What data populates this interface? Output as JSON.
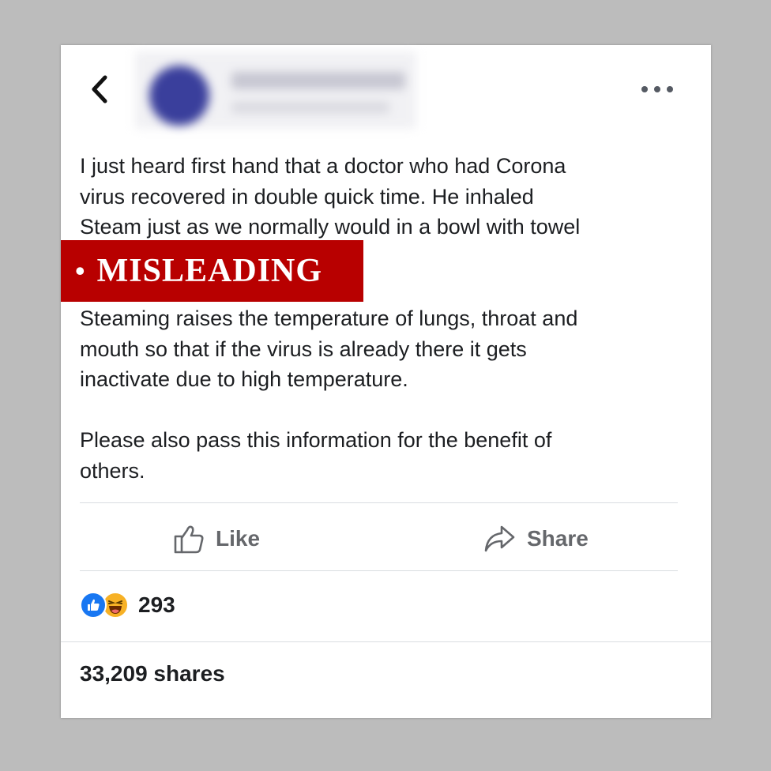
{
  "post": {
    "text_before": "I just heard first hand that a doctor who had Corona\nvirus recovered in double quick time. He inhaled\nSteam just as we normally would in a bowl with towel",
    "text_after": "Steaming raises the temperature of lungs, throat and\nmouth so that if the virus is already there it gets\ninactivate due to high temperature.\n\nPlease also pass this information for the benefit of\nothers."
  },
  "label": {
    "bullet": "•",
    "text": "MISLEADING",
    "color": "#b80000"
  },
  "actions": {
    "like_label": "Like",
    "share_label": "Share"
  },
  "reactions": {
    "count": "293",
    "icons": [
      "like-icon",
      "haha-icon"
    ]
  },
  "shares": {
    "text": "33,209 shares"
  },
  "colors": {
    "background": "#bcbcbc",
    "card": "#ffffff",
    "text": "#1c1e21",
    "muted": "#65676b",
    "like_blue": "#1877f2",
    "haha_yellow": "#f7b125"
  }
}
